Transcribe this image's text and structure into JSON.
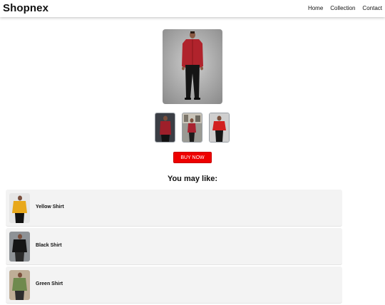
{
  "header": {
    "brand": "Shopnex",
    "nav": [
      "Home",
      "Collection",
      "Contact"
    ]
  },
  "product": {
    "main_image": "red-shirt-model-photo",
    "thumbnails": [
      "red-shirt-side-view",
      "red-shirt-street-view",
      "red-shirt-front-view"
    ],
    "buy_label": "BUY NOW",
    "buy_color": "#ee0000"
  },
  "recommendations": {
    "heading": "You may like:",
    "items": [
      {
        "name": "Yellow Shirt",
        "image": "yellow-shirt-photo"
      },
      {
        "name": "Black Shirt",
        "image": "black-shirt-photo"
      },
      {
        "name": "Green Shirt",
        "image": "green-shirt-photo"
      }
    ]
  }
}
